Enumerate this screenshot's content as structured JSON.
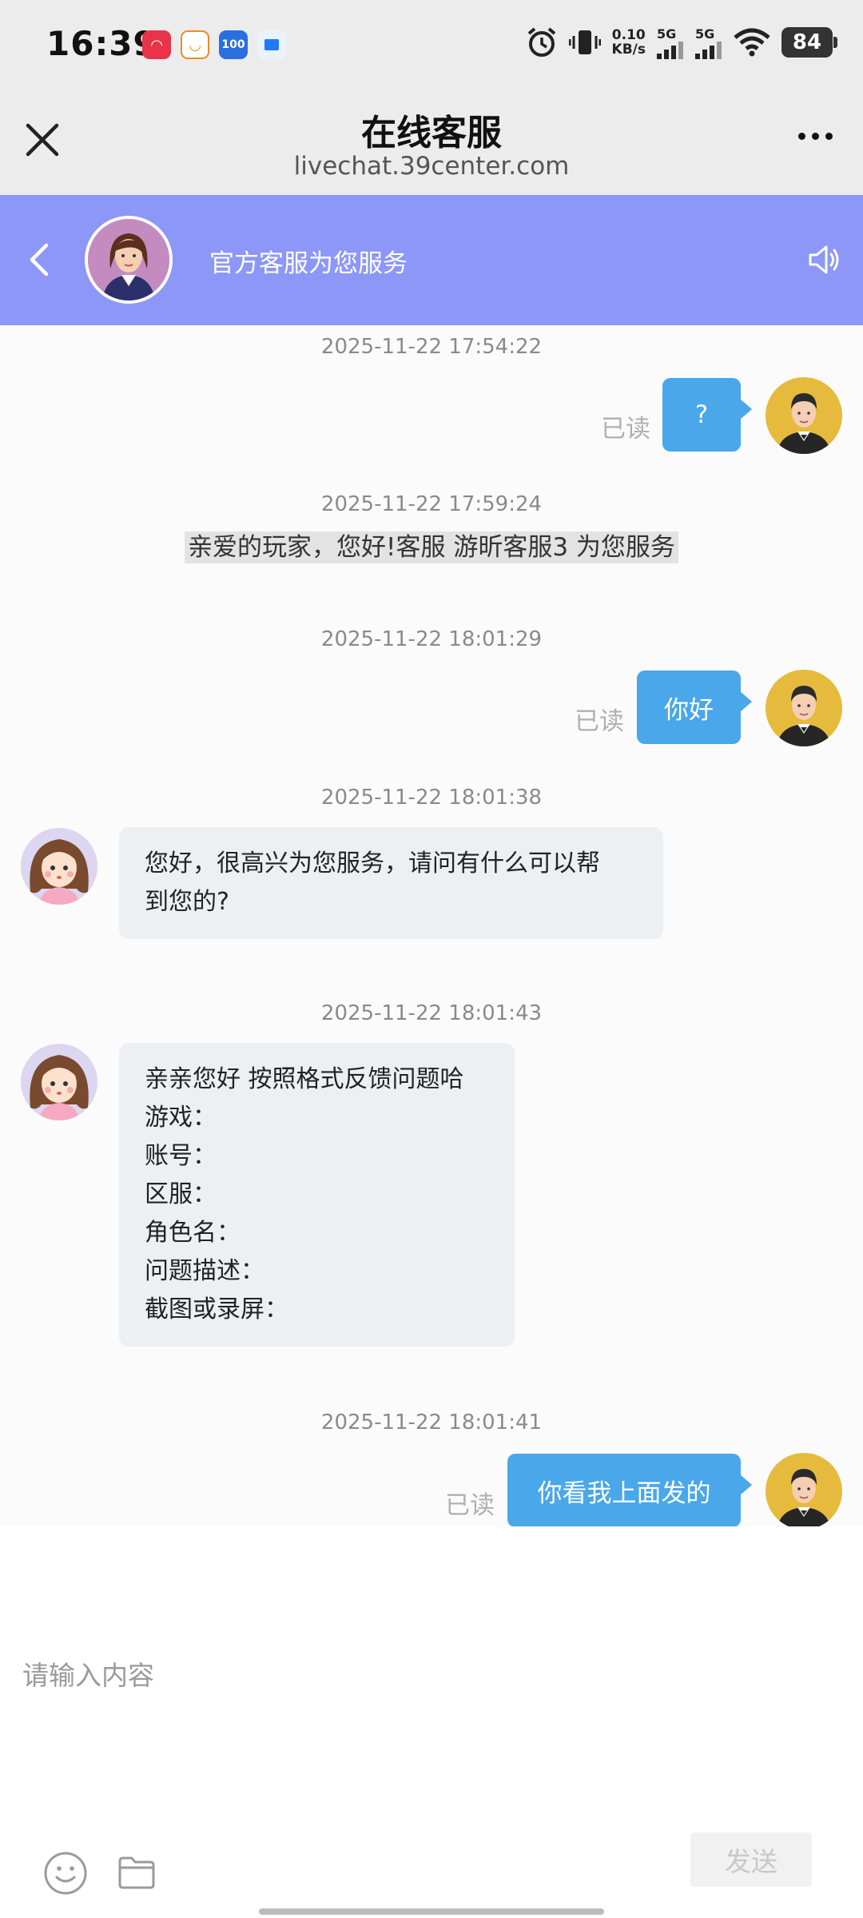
{
  "status_bar": {
    "time": "16:39",
    "net_speed_value": "0.10",
    "net_speed_unit": "KB/s",
    "signal1_label": "5G",
    "signal2_label": "5G",
    "battery": "84"
  },
  "webview": {
    "title": "在线客服",
    "url": "livechat.39center.com"
  },
  "chat_header": {
    "title": "官方客服为您服务"
  },
  "messages": {
    "m1": {
      "time": "2025-11-22 17:54:22",
      "text": "?",
      "read": "已读"
    },
    "m2": {
      "time": "2025-11-22 17:59:24",
      "text": "亲爱的玩家，您好!客服 游昕客服3 为您服务"
    },
    "m3": {
      "time": "2025-11-22 18:01:29",
      "text": "你好",
      "read": "已读"
    },
    "m4": {
      "time": "2025-11-22 18:01:38",
      "line1": "您好，很高兴为您服务，请问有什么可以帮",
      "line2": "到您的?"
    },
    "m5": {
      "time": "2025-11-22 18:01:43",
      "lines": [
        "亲亲您好 按照格式反馈问题哈",
        "游戏：",
        "账号：",
        "区服：",
        "角色名：",
        "问题描述：",
        "截图或录屏："
      ]
    },
    "m6": {
      "time": "2025-11-22 18:01:41",
      "text": "你看我上面发的",
      "read": "已读"
    }
  },
  "input": {
    "placeholder": "请输入内容",
    "send_label": "发送"
  },
  "colors": {
    "header": "#8c97f7",
    "my_bubble": "#49a7ea",
    "cs_bubble": "#ecf0f2"
  }
}
